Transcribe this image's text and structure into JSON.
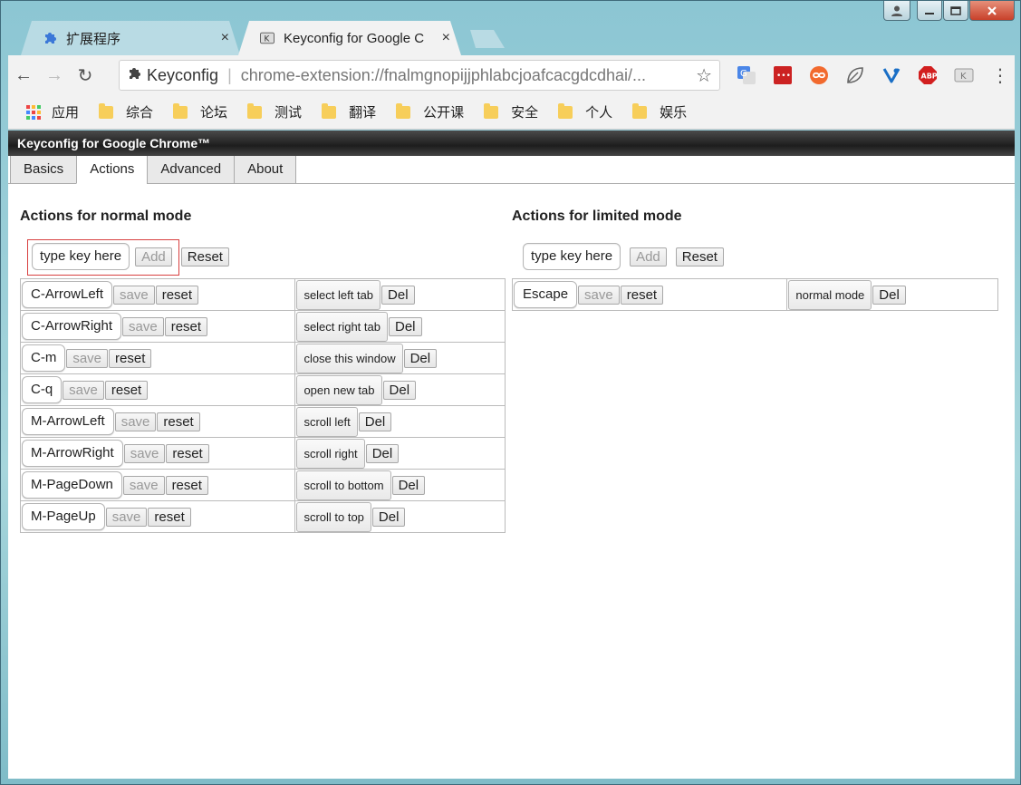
{
  "window": {
    "tabs": [
      {
        "title": "扩展程序",
        "icon": "puzzle-icon",
        "active": false
      },
      {
        "title": "Keyconfig for Google C",
        "icon": "keyconfig-icon",
        "active": true
      }
    ],
    "tab_close": "×"
  },
  "toolbar": {
    "back": "←",
    "forward": "→",
    "reload": "↻",
    "site_name": "Keyconfig",
    "url": "chrome-extension://fnalmgnopijjphlabcjoafcacgdcdhai/...",
    "star": "☆",
    "extensions": [
      "google-translate-icon",
      "lastpass-icon",
      "infinity-icon",
      "leaf-icon",
      "vivaldi-icon",
      "adblock-plus-icon",
      "keyconfig-icon"
    ],
    "adblock_label": "ABP",
    "lastpass_label": "•••",
    "menu": "⋮"
  },
  "bookmarks": {
    "apps_label": "应用",
    "folders": [
      "综合",
      "论坛",
      "测试",
      "翻译",
      "公开课",
      "安全",
      "个人",
      "娱乐"
    ]
  },
  "page": {
    "header_title": "Keyconfig for Google Chrome™",
    "tabs": [
      "Basics",
      "Actions",
      "Advanced",
      "About"
    ],
    "active_tab": "Actions",
    "normal": {
      "heading": "Actions for normal mode",
      "input_placeholder": "type key here",
      "add_label": "Add",
      "reset_label": "Reset",
      "rows": [
        {
          "key": "C-ArrowLeft",
          "action": "select left tab"
        },
        {
          "key": "C-ArrowRight",
          "action": "select right tab"
        },
        {
          "key": "C-m",
          "action": "close this window"
        },
        {
          "key": "C-q",
          "action": "open new tab"
        },
        {
          "key": "M-ArrowLeft",
          "action": "scroll left"
        },
        {
          "key": "M-ArrowRight",
          "action": "scroll right"
        },
        {
          "key": "M-PageDown",
          "action": "scroll to bottom"
        },
        {
          "key": "M-PageUp",
          "action": "scroll to top"
        }
      ]
    },
    "limited": {
      "heading": "Actions for limited mode",
      "input_placeholder": "type key here",
      "add_label": "Add",
      "reset_label": "Reset",
      "rows": [
        {
          "key": "Escape",
          "action": "normal mode"
        }
      ]
    },
    "row_buttons": {
      "save": "save",
      "reset": "reset",
      "del": "Del"
    }
  },
  "colors": {
    "highlight_border": "#d84040",
    "header_bg": "#2a2a2a"
  }
}
